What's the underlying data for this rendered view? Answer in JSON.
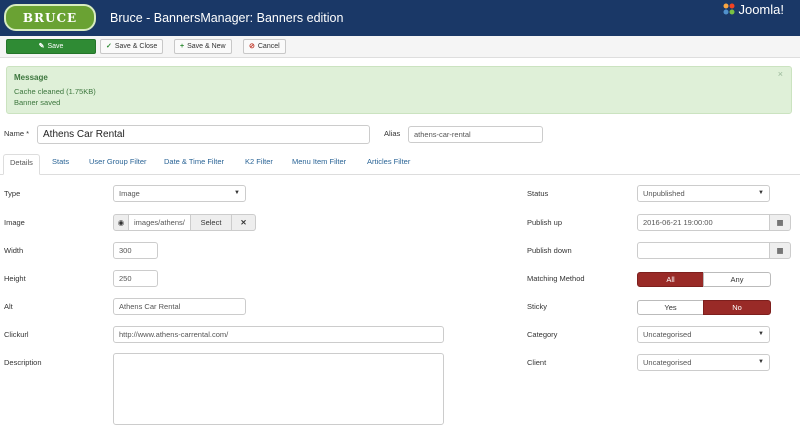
{
  "header": {
    "logo_text": "BRUCE",
    "title": "Bruce - BannersManager: Banners edition",
    "brand": "Joomla!"
  },
  "toolbar": {
    "save": "Save",
    "save_close": "Save & Close",
    "save_new": "Save & New",
    "cancel": "Cancel"
  },
  "message": {
    "heading": "Message",
    "line1": "Cache cleaned (1.75KB)",
    "line2": "Banner saved",
    "close": "×"
  },
  "name": {
    "label": "Name *",
    "value": "Athens Car Rental"
  },
  "alias": {
    "label": "Alias",
    "value": "athens-car-rental"
  },
  "tabs": [
    "Details",
    "Stats",
    "User Group Filter",
    "Date & Time Filter",
    "K2 Filter",
    "Menu Item Filter",
    "Articles Filter"
  ],
  "details": {
    "type": {
      "label": "Type",
      "value": "Image"
    },
    "image": {
      "label": "Image",
      "value": "images/athens/",
      "select": "Select",
      "clear": "✕"
    },
    "width": {
      "label": "Width",
      "value": "300"
    },
    "height": {
      "label": "Height",
      "value": "250"
    },
    "alt": {
      "label": "Alt",
      "value": "Athens Car Rental"
    },
    "clickurl": {
      "label": "Clickurl",
      "value": "http://www.athens-carrental.com/"
    },
    "description": {
      "label": "Description",
      "value": ""
    }
  },
  "sidebar": {
    "status": {
      "label": "Status",
      "value": "Unpublished"
    },
    "publish_up": {
      "label": "Publish up",
      "value": "2016-06-21 19:00:00"
    },
    "publish_down": {
      "label": "Publish down",
      "value": ""
    },
    "matching": {
      "label": "Matching Method",
      "options": [
        "All",
        "Any"
      ],
      "selected": "All"
    },
    "sticky": {
      "label": "Sticky",
      "options": [
        "Yes",
        "No"
      ],
      "selected": "No"
    },
    "category": {
      "label": "Category",
      "value": "Uncategorised"
    },
    "client": {
      "label": "Client",
      "value": "Uncategorised"
    }
  },
  "colors": {
    "header_bg": "#1a3867",
    "save_green": "#2f8b34",
    "active_toggle": "#992a27",
    "alert_bg": "#dff0d8"
  }
}
